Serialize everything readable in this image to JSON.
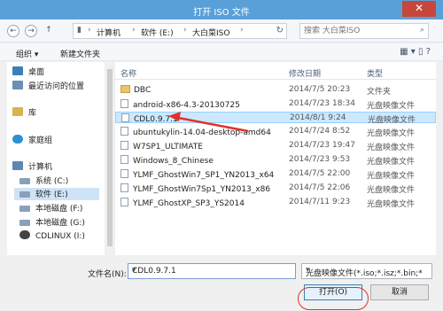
{
  "window": {
    "title": "打开 ISO 文件",
    "close_glyph": "✕"
  },
  "address": {
    "segments": [
      "计算机",
      "软件 (E:)",
      "大白菜ISO"
    ],
    "search_placeholder": "搜索 大白菜ISO"
  },
  "toolbar": {
    "organize": "组织 ▾",
    "new_folder": "新建文件夹"
  },
  "sidebar": {
    "items": [
      {
        "label": "桌面",
        "icon": "desktop-icon",
        "color": "#3c7fb8"
      },
      {
        "label": "最近访问的位置",
        "icon": "recent-places-icon",
        "color": "#6b8fb5"
      },
      {
        "label": "库",
        "icon": "library-icon",
        "color": "#d9b34e"
      },
      {
        "label": "家庭组",
        "icon": "homegroup-icon",
        "color": "#2f8fd1"
      },
      {
        "label": "计算机",
        "icon": "computer-icon",
        "color": "#5d86b3"
      },
      {
        "label": "系统 (C:)",
        "icon": "drive-icon",
        "color": "#8aa0b8"
      },
      {
        "label": "软件 (E:)",
        "icon": "drive-icon",
        "color": "#8aa0b8"
      },
      {
        "label": "本地磁盘 (F:)",
        "icon": "drive-icon",
        "color": "#8aa0b8"
      },
      {
        "label": "本地磁盘 (G:)",
        "icon": "drive-icon",
        "color": "#8aa0b8"
      },
      {
        "label": "CDLINUX (I:)",
        "icon": "disc-drive-icon",
        "color": "#444"
      }
    ]
  },
  "filelist": {
    "columns": [
      "名称",
      "修改日期",
      "类型"
    ],
    "rows": [
      {
        "name": "DBC",
        "date": "2014/7/5 20:23",
        "type": "文件夹",
        "kind": "folder"
      },
      {
        "name": "android-x86-4.3-20130725",
        "date": "2014/7/23 18:34",
        "type": "光盘映像文件",
        "kind": "file"
      },
      {
        "name": "CDL0.9.7.1",
        "date": "2014/8/1 9:24",
        "type": "光盘映像文件",
        "kind": "file"
      },
      {
        "name": "ubuntukylin-14.04-desktop-amd64",
        "date": "2014/7/24 8:52",
        "type": "光盘映像文件",
        "kind": "file"
      },
      {
        "name": "W7SP1_ULTIMATE",
        "date": "2014/7/23 19:47",
        "type": "光盘映像文件",
        "kind": "file"
      },
      {
        "name": "Windows_8_Chinese",
        "date": "2014/7/23 9:53",
        "type": "光盘映像文件",
        "kind": "file"
      },
      {
        "name": "YLMF_GhostWin7_SP1_YN2013_x64",
        "date": "2014/7/5 22:00",
        "type": "光盘映像文件",
        "kind": "file"
      },
      {
        "name": "YLMF_GhostWin7Sp1_YN2013_x86",
        "date": "2014/7/5 22:06",
        "type": "光盘映像文件",
        "kind": "file"
      },
      {
        "name": "YLMF_GhostXP_SP3_YS2014",
        "date": "2014/7/11 9:23",
        "type": "光盘映像文件",
        "kind": "file"
      }
    ],
    "selected_index": 2
  },
  "footer": {
    "filename_label": "文件名(N):",
    "filename_value": "CDL0.9.7.1",
    "filetype_value": "光盘映像文件(*.iso;*.isz;*.bin;*",
    "open_label": "打开(O)",
    "cancel_label": "取消"
  },
  "colors": {
    "title_bar": "#5aa0d8",
    "annotation": "#e0322a",
    "selection": "#cce8ff"
  }
}
